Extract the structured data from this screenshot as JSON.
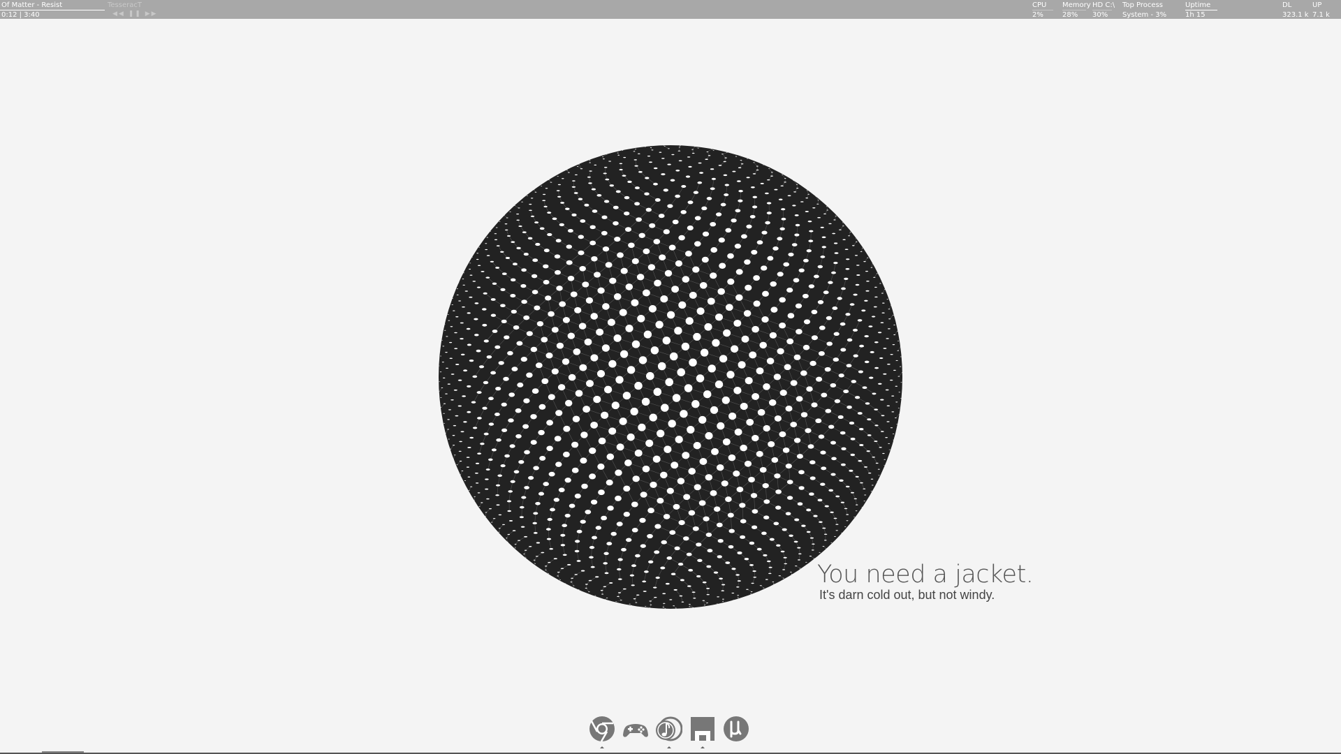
{
  "colors": {
    "topbar_bg": "#a8a8a8",
    "desktop_bg": "#f4f4f4",
    "sphere_fill": "#222222",
    "dot_fill": "#ffffff"
  },
  "media": {
    "track": "Of Matter - Resist",
    "time": "0:12  |  3:40",
    "next_title": "TesseracT",
    "prev_icon": "rewind-icon",
    "pause_icon": "pause-icon",
    "next_icon": "fast-forward-icon",
    "progress": 0.05
  },
  "stats": {
    "cpu": {
      "label": "CPU",
      "value": "2%",
      "level": 0.02
    },
    "memory": {
      "label": "Memory",
      "value": "28%",
      "level": 0.28
    },
    "hd": {
      "label": "HD C:\\",
      "value": "30%",
      "level": 0.3
    },
    "top_process": {
      "label": "Top Process",
      "value": "System - 3%"
    },
    "uptime": {
      "label": "Uptime",
      "value": "1h 15"
    },
    "dl": {
      "label": "DL",
      "value": "323.1 k"
    },
    "up": {
      "label": "UP",
      "value": "7.1 k"
    }
  },
  "weather": {
    "headline": "You need a jacket.",
    "detail": "It's darn cold out, but not windy."
  },
  "dock": [
    {
      "icon": "chrome-icon",
      "running": true
    },
    {
      "icon": "gamepad-icon",
      "running": false
    },
    {
      "icon": "music-player-icon",
      "running": true
    },
    {
      "icon": "save-disk-icon",
      "running": true
    },
    {
      "icon": "utorrent-icon",
      "running": false
    }
  ]
}
